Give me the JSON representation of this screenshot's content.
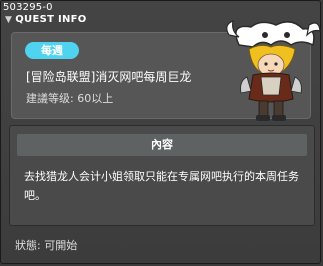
{
  "window": {
    "quest_id": "503295-0",
    "title": "QUEST INFO"
  },
  "quest": {
    "tag": "每週",
    "name": "[冒险岛联盟]消灭网吧每周巨龙",
    "level": "建議等级: 60以上"
  },
  "content": {
    "header": "內容",
    "text": "去找猎龙人会计小姐领取只能在专属网吧执行的本周任务吧。"
  },
  "status": {
    "text": "狀態: 可開始"
  },
  "colors": {
    "tag_bg": "#50d3f0",
    "window_bg": "#3c3c3c",
    "panel_bg": "#565656"
  }
}
